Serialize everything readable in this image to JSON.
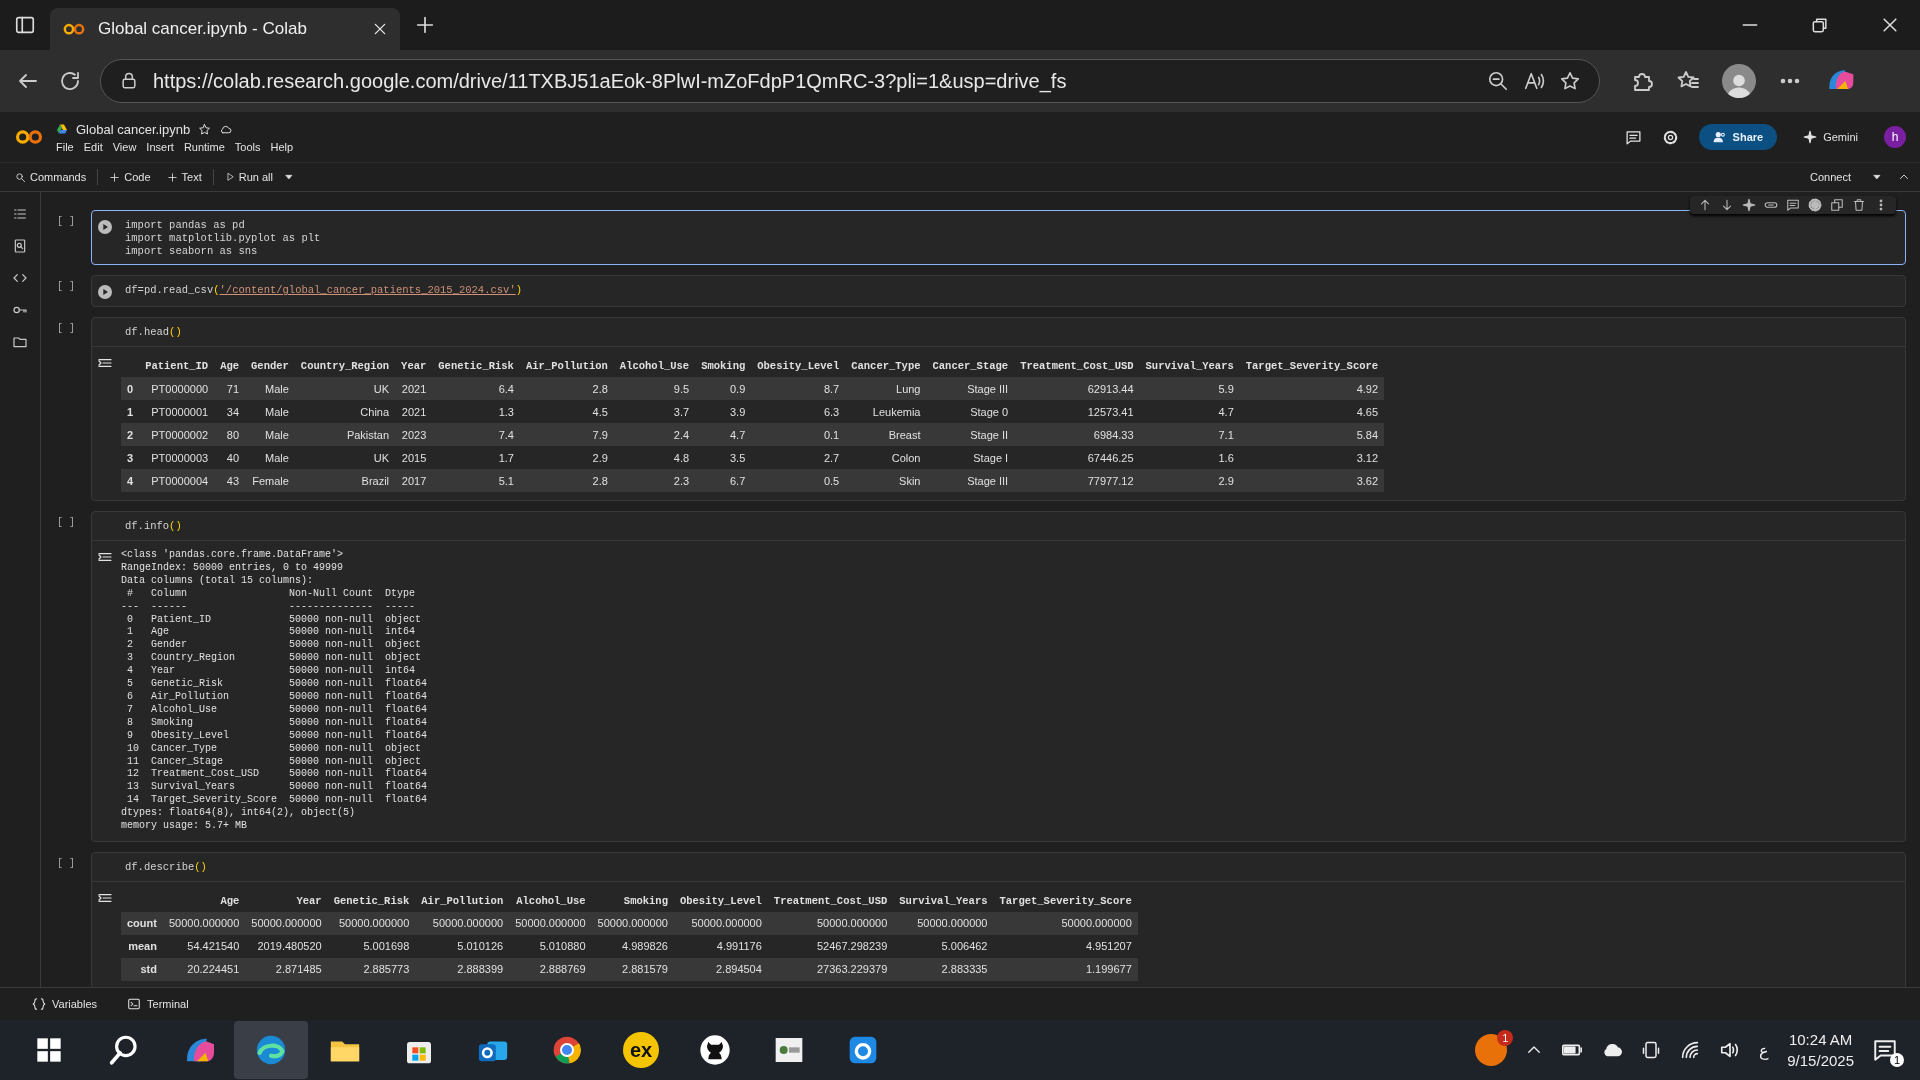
{
  "browser": {
    "tab_title": "Global cancer.ipynb - Colab",
    "url": "https://colab.research.google.com/drive/11TXBJ51aEok-8PlwI-mZoFdpP1QmRC-3?pli=1&usp=drive_fs"
  },
  "notebook": {
    "name": "Global cancer.ipynb",
    "menu": [
      "File",
      "Edit",
      "View",
      "Insert",
      "Runtime",
      "Tools",
      "Help"
    ],
    "share": "Share",
    "gemini": "Gemini",
    "avatar": "h"
  },
  "toolbar": {
    "commands": "Commands",
    "code": "Code",
    "text": "Text",
    "run_all": "Run all",
    "connect": "Connect"
  },
  "cells": [
    {
      "prompt": "[ ]",
      "focused": true,
      "run_icon": true,
      "code": [
        [
          {
            "kind": "plain",
            "text": "import pandas as pd"
          }
        ],
        [
          {
            "kind": "plain",
            "text": "import matplotlib.pyplot as plt"
          }
        ],
        [
          {
            "kind": "plain",
            "text": "import seaborn as sns"
          }
        ]
      ]
    },
    {
      "prompt": "[ ]",
      "focused": false,
      "run_icon": true,
      "code": [
        [
          {
            "kind": "plain",
            "text": "df=pd.read_csv"
          },
          {
            "kind": "paren",
            "text": "("
          },
          {
            "kind": "string",
            "text": "'/content/global_cancer_patients_2015_2024.csv'"
          },
          {
            "kind": "paren",
            "text": ")"
          }
        ]
      ]
    },
    {
      "prompt": "[ ]",
      "focused": false,
      "run_icon": false,
      "code": [
        [
          {
            "kind": "plain",
            "text": "df.head"
          },
          {
            "kind": "paren",
            "text": "()"
          }
        ]
      ],
      "output": {
        "kind": "table",
        "columns": [
          "Patient_ID",
          "Age",
          "Gender",
          "Country_Region",
          "Year",
          "Genetic_Risk",
          "Air_Pollution",
          "Alcohol_Use",
          "Smoking",
          "Obesity_Level",
          "Cancer_Type",
          "Cancer_Stage",
          "Treatment_Cost_USD",
          "Survival_Years",
          "Target_Severity_Score"
        ],
        "rows": [
          {
            "index": "0",
            "cells": [
              "PT0000000",
              "71",
              "Male",
              "UK",
              "2021",
              "6.4",
              "2.8",
              "9.5",
              "0.9",
              "8.7",
              "Lung",
              "Stage III",
              "62913.44",
              "5.9",
              "4.92"
            ]
          },
          {
            "index": "1",
            "cells": [
              "PT0000001",
              "34",
              "Male",
              "China",
              "2021",
              "1.3",
              "4.5",
              "3.7",
              "3.9",
              "6.3",
              "Leukemia",
              "Stage 0",
              "12573.41",
              "4.7",
              "4.65"
            ]
          },
          {
            "index": "2",
            "cells": [
              "PT0000002",
              "80",
              "Male",
              "Pakistan",
              "2023",
              "7.4",
              "7.9",
              "2.4",
              "4.7",
              "0.1",
              "Breast",
              "Stage II",
              "6984.33",
              "7.1",
              "5.84"
            ]
          },
          {
            "index": "3",
            "cells": [
              "PT0000003",
              "40",
              "Male",
              "UK",
              "2015",
              "1.7",
              "2.9",
              "4.8",
              "3.5",
              "2.7",
              "Colon",
              "Stage I",
              "67446.25",
              "1.6",
              "3.12"
            ]
          },
          {
            "index": "4",
            "cells": [
              "PT0000004",
              "43",
              "Female",
              "Brazil",
              "2017",
              "5.1",
              "2.8",
              "2.3",
              "6.7",
              "0.5",
              "Skin",
              "Stage III",
              "77977.12",
              "2.9",
              "3.62"
            ]
          }
        ]
      }
    },
    {
      "prompt": "[ ]",
      "focused": false,
      "run_icon": false,
      "code": [
        [
          {
            "kind": "plain",
            "text": "df.info"
          },
          {
            "kind": "paren",
            "text": "()"
          }
        ]
      ],
      "output": {
        "kind": "text",
        "lines": [
          "<class 'pandas.core.frame.DataFrame'>",
          "RangeIndex: 50000 entries, 0 to 49999",
          "Data columns (total 15 columns):",
          " #   Column                 Non-Null Count  Dtype",
          "---  ------                 --------------  -----",
          " 0   Patient_ID             50000 non-null  object",
          " 1   Age                    50000 non-null  int64",
          " 2   Gender                 50000 non-null  object",
          " 3   Country_Region         50000 non-null  object",
          " 4   Year                   50000 non-null  int64",
          " 5   Genetic_Risk           50000 non-null  float64",
          " 6   Air_Pollution          50000 non-null  float64",
          " 7   Alcohol_Use            50000 non-null  float64",
          " 8   Smoking                50000 non-null  float64",
          " 9   Obesity_Level          50000 non-null  float64",
          " 10  Cancer_Type            50000 non-null  object",
          " 11  Cancer_Stage           50000 non-null  object",
          " 12  Treatment_Cost_USD     50000 non-null  float64",
          " 13  Survival_Years         50000 non-null  float64",
          " 14  Target_Severity_Score  50000 non-null  float64",
          "dtypes: float64(8), int64(2), object(5)",
          "memory usage: 5.7+ MB"
        ]
      }
    },
    {
      "prompt": "[ ]",
      "focused": false,
      "run_icon": false,
      "code": [
        [
          {
            "kind": "plain",
            "text": "df.describe"
          },
          {
            "kind": "paren",
            "text": "()"
          }
        ]
      ],
      "output": {
        "kind": "table",
        "columns": [
          "Age",
          "Year",
          "Genetic_Risk",
          "Air_Pollution",
          "Alcohol_Use",
          "Smoking",
          "Obesity_Level",
          "Treatment_Cost_USD",
          "Survival_Years",
          "Target_Severity_Score"
        ],
        "rows": [
          {
            "index": "count",
            "cells": [
              "50000.000000",
              "50000.000000",
              "50000.000000",
              "50000.000000",
              "50000.000000",
              "50000.000000",
              "50000.000000",
              "50000.000000",
              "50000.000000",
              "50000.000000"
            ]
          },
          {
            "index": "mean",
            "cells": [
              "54.421540",
              "2019.480520",
              "5.001698",
              "5.010126",
              "5.010880",
              "4.989826",
              "4.991176",
              "52467.298239",
              "5.006462",
              "4.951207"
            ]
          },
          {
            "index": "std",
            "cells": [
              "20.224451",
              "2.871485",
              "2.885773",
              "2.888399",
              "2.888769",
              "2.881579",
              "2.894504",
              "27363.229379",
              "2.883335",
              "1.199677"
            ]
          }
        ]
      }
    }
  ],
  "bottom_bar": {
    "variables": "Variables",
    "terminal": "Terminal"
  },
  "taskbar": {
    "apps": [
      {
        "kind": "start",
        "selected": false
      },
      {
        "kind": "search",
        "selected": false
      },
      {
        "kind": "swirl",
        "selected": false
      },
      {
        "kind": "browser",
        "selected": true
      },
      {
        "kind": "folder",
        "selected": false
      },
      {
        "kind": "store",
        "selected": false
      },
      {
        "kind": "mail",
        "selected": false
      },
      {
        "kind": "circle",
        "selected": false
      },
      {
        "kind": "ex",
        "label": "ex",
        "selected": false
      },
      {
        "kind": "cat",
        "selected": false
      },
      {
        "kind": "tile",
        "selected": false
      },
      {
        "kind": "blue",
        "selected": false
      }
    ],
    "tray": {
      "badge": "1",
      "language": "ع",
      "time": "10:24 AM",
      "date": "9/15/2025",
      "notifications": "1"
    }
  }
}
